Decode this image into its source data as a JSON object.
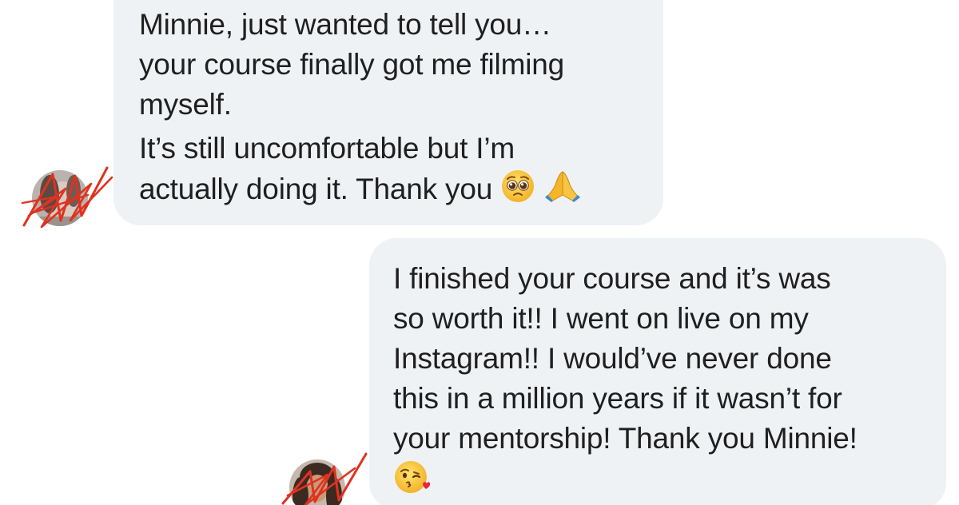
{
  "conversation": {
    "messages": [
      {
        "side": "left",
        "lines": [
          "Minnie, just wanted to tell you…",
          "your course finally got me filming",
          "myself.",
          "It’s still uncomfortable but I’m",
          "actually doing it. Thank you"
        ],
        "emojis": [
          "pleading-face",
          "folded-hands"
        ]
      },
      {
        "side": "right",
        "lines": [
          "I finished your course and it’s was",
          "so worth it!! I went on live on my",
          "Instagram!! I would’ve never done",
          "this in a million years if it wasn’t for",
          "your mentorship! Thank you Minnie!"
        ],
        "emojis": [
          "face-blowing-a-kiss"
        ]
      }
    ]
  },
  "colors": {
    "bubble": "#eff2f5",
    "text": "#1f1f1f",
    "redaction_scribble": "#e0321f"
  }
}
